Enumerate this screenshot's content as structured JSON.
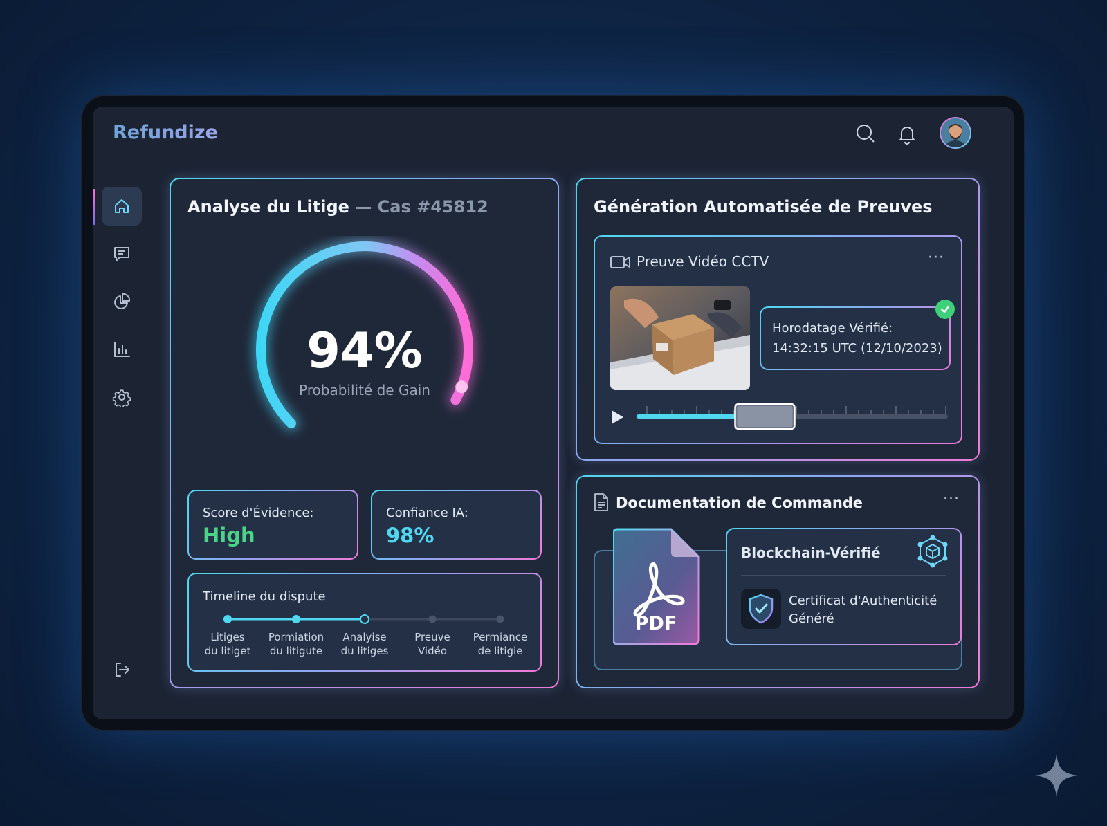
{
  "app": {
    "brand": "Refundize"
  },
  "topbar": {
    "search_icon": "search-icon",
    "bell_icon": "bell-icon",
    "avatar": "avatar"
  },
  "sidebar": {
    "items": [
      {
        "icon": "home-icon",
        "active": true
      },
      {
        "icon": "message-icon",
        "active": false
      },
      {
        "icon": "pie-chart-icon",
        "active": false
      },
      {
        "icon": "bar-chart-icon",
        "active": false
      },
      {
        "icon": "gear-icon",
        "active": false
      }
    ],
    "logout_icon": "logout-icon"
  },
  "analysis": {
    "title": "Analyse du Litige",
    "case": "— Cas #45812",
    "gauge_value": "94%",
    "gauge_fraction": 0.94,
    "gauge_label": "Probabilité de Gain",
    "score_label": "Score d'Évidence:",
    "score_value": "High",
    "confidence_label": "Confiance IA:",
    "confidence_value": "98%",
    "timeline_title": "Timeline du dispute",
    "timeline": [
      {
        "line1": "Litiges",
        "line2": "du litiget",
        "state": "done"
      },
      {
        "line1": "Pormiation",
        "line2": "du litigute",
        "state": "done"
      },
      {
        "line1": "Analyise",
        "line2": "du litiges",
        "state": "current"
      },
      {
        "line1": "Preuve",
        "line2": "Vidéo",
        "state": "pending"
      },
      {
        "line1": "Permiance",
        "line2": "de litigie",
        "state": "pending"
      }
    ]
  },
  "evidence": {
    "title": "Génération Automatisée de Preuves",
    "video_title": "Preuve Vidéo CCTV",
    "more": "···",
    "timestamp_label": "Horodatage Vérifié:",
    "timestamp_value": "14:32:15 UTC (12/10/2023)",
    "video_progress": 0.33
  },
  "docs": {
    "title": "Documentation de Commande",
    "more": "···",
    "pdf_label": "PDF",
    "blockchain_title": "Blockchain-Vérifié",
    "certificate_line1": "Certificat d'Authenticité",
    "certificate_line2": "Généré"
  },
  "colors": {
    "cyan": "#4fd8f0",
    "pink": "#f07ad8",
    "green": "#3fd07a"
  }
}
